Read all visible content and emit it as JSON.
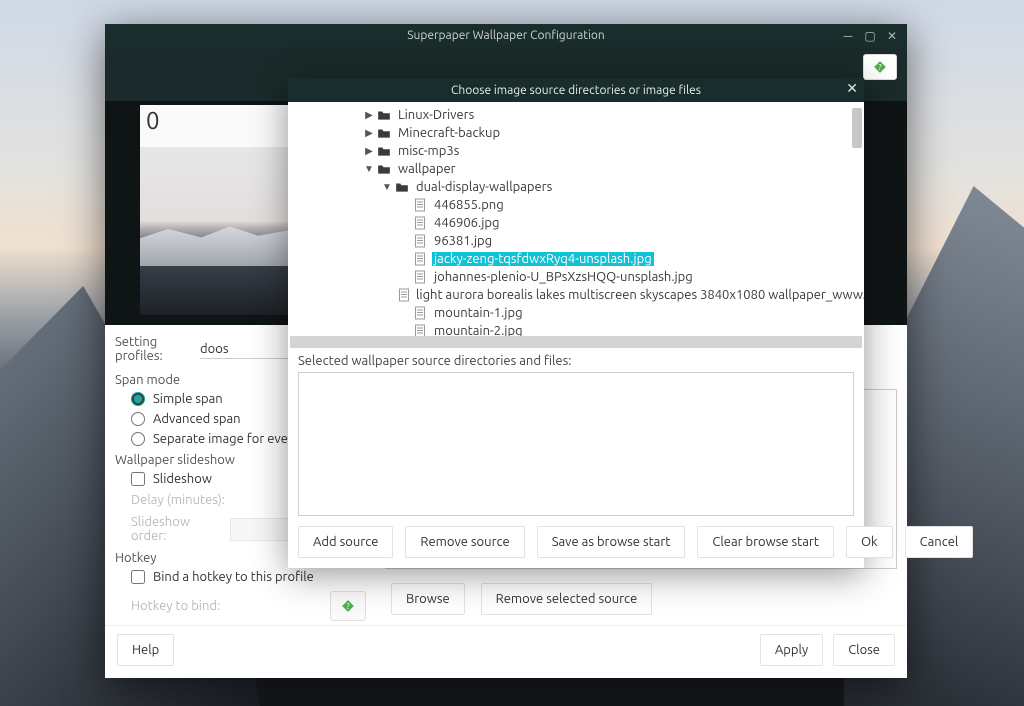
{
  "window": {
    "title": "Superpaper Wallpaper Configuration"
  },
  "preview": {
    "monitor_label": "0"
  },
  "settings": {
    "profiles_label": "Setting profiles:",
    "profile_value": "doos",
    "span_mode_label": "Span mode",
    "radios": {
      "simple": "Simple span",
      "advanced": "Advanced span",
      "separate": "Separate image for every display"
    },
    "slideshow_label": "Wallpaper slideshow",
    "slideshow_check": "Slideshow",
    "delay_label": "Delay (minutes):",
    "order_label": "Slideshow order:",
    "hotkey_label": "Hotkey",
    "hotkey_check": "Bind a hotkey to this profile",
    "hotkey_bind_label": "Hotkey to bind:"
  },
  "right": {
    "browse": "Browse",
    "remove_selected": "Remove selected source"
  },
  "footer": {
    "help": "Help",
    "apply": "Apply",
    "close": "Close"
  },
  "modal": {
    "title": "Choose image source directories or image files",
    "tree": [
      {
        "indent": 3,
        "arrow": "▶",
        "type": "folder",
        "name": "Linux-Drivers"
      },
      {
        "indent": 3,
        "arrow": "▶",
        "type": "folder",
        "name": "Minecraft-backup"
      },
      {
        "indent": 3,
        "arrow": "▶",
        "type": "folder",
        "name": "misc-mp3s"
      },
      {
        "indent": 3,
        "arrow": "▼",
        "type": "folder",
        "name": "wallpaper"
      },
      {
        "indent": 4,
        "arrow": "▼",
        "type": "folder",
        "name": "dual-display-wallpapers"
      },
      {
        "indent": 5,
        "arrow": "",
        "type": "file",
        "name": "446855.png"
      },
      {
        "indent": 5,
        "arrow": "",
        "type": "file",
        "name": "446906.jpg"
      },
      {
        "indent": 5,
        "arrow": "",
        "type": "file",
        "name": "96381.jpg"
      },
      {
        "indent": 5,
        "arrow": "",
        "type": "file",
        "name": "jacky-zeng-tqsfdwxRyq4-unsplash.jpg",
        "selected": true
      },
      {
        "indent": 5,
        "arrow": "",
        "type": "file",
        "name": "johannes-plenio-U_BPsXzsHQQ-unsplash.jpg"
      },
      {
        "indent": 5,
        "arrow": "",
        "type": "file",
        "name": "light aurora borealis lakes multiscreen skyscapes 3840x1080 wallpaper_www.wallpaperhi.com_"
      },
      {
        "indent": 5,
        "arrow": "",
        "type": "file",
        "name": "mountain-1.jpg"
      },
      {
        "indent": 5,
        "arrow": "",
        "type": "file",
        "name": "mountain-2.jpg"
      }
    ],
    "selected_label": "Selected wallpaper source directories and files:",
    "buttons": {
      "add": "Add source",
      "remove": "Remove source",
      "save_start": "Save as browse start",
      "clear_start": "Clear browse start",
      "ok": "Ok",
      "cancel": "Cancel"
    }
  }
}
